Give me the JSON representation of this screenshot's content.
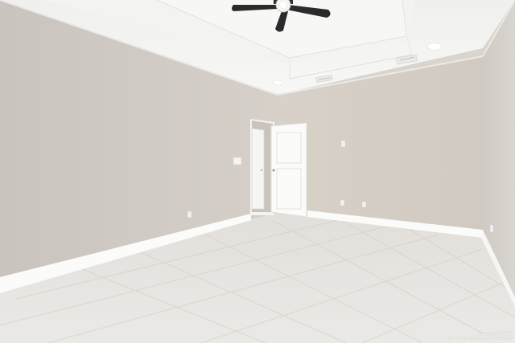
{
  "watermark": {
    "line1": "Copyright 2025",
    "line2": "San Antonio Board of Realtors"
  },
  "colors": {
    "left_wall": "#cfcac4",
    "back_wall": "#d6cfc6",
    "right_wall": "#d3cec8",
    "ceiling": "#f5f5f3",
    "floor": "#e6e4e1",
    "baseboard": "#ffffff",
    "door": "#ffffff",
    "fan": "#2b2b2b"
  }
}
